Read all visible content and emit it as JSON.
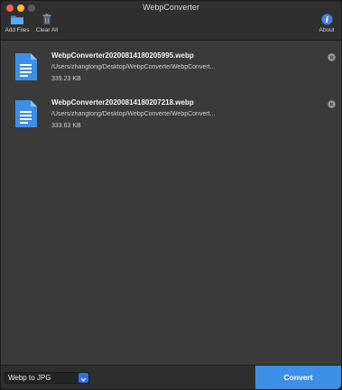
{
  "window": {
    "title": "WebpConverter"
  },
  "toolbar": {
    "add_files_label": "Add Files",
    "clear_all_label": "Clear All",
    "about_label": "About",
    "about_glyph": "i",
    "accent_color": "#3d8ee6"
  },
  "files": [
    {
      "name": "WebpConverter20200814180205995.webp",
      "path": "/Users/zhangtong/Desktop/WebpConverte/WebpConvert...",
      "size": "339.23 KB"
    },
    {
      "name": "WebpConverter20200814180207218.webp",
      "path": "/Users/zhangtong/Desktop/WebpConverte/WebpConvert...",
      "size": "333.63 KB"
    }
  ],
  "bottombar": {
    "format_selected": "Webp to JPG",
    "convert_label": "Convert"
  }
}
